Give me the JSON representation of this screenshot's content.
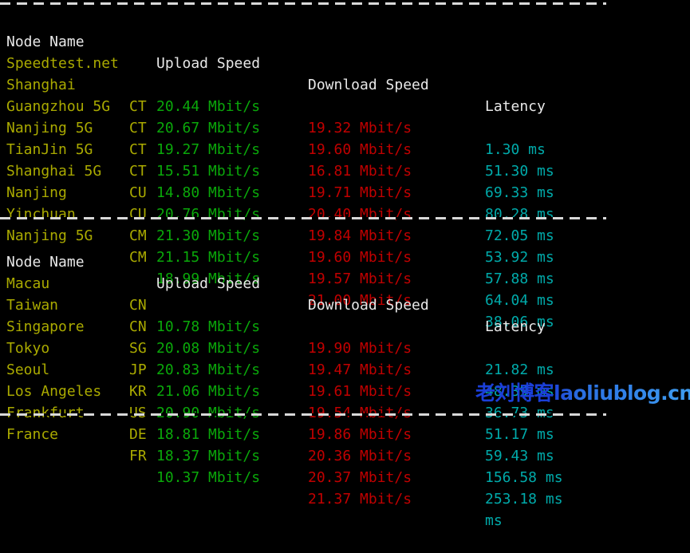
{
  "terminal": {
    "background_color": "#000000",
    "separator_color": "#d8d8d8"
  },
  "colors": {
    "header": "#e8e8e8",
    "node_name": "#aaaa00",
    "isp": "#aaaa00",
    "upload": "#0aa80a",
    "download": "#c00000",
    "latency": "#00aaaa",
    "watermark": "#1b3fd8"
  },
  "headers": {
    "node_name": "Node Name",
    "isp": "",
    "upload_speed": "Upload Speed",
    "download_speed": "Download Speed",
    "latency": "Latency"
  },
  "table_domestic": {
    "rows": [
      {
        "node": "Speedtest.net",
        "isp": "",
        "upload": "20.44 Mbit/s",
        "download": "19.32 Mbit/s",
        "latency": "1.30 ms"
      },
      {
        "node": "Shanghai",
        "isp": "CT",
        "upload": "20.67 Mbit/s",
        "download": "19.60 Mbit/s",
        "latency": "51.30 ms"
      },
      {
        "node": "Guangzhou 5G",
        "isp": "CT",
        "upload": "19.27 Mbit/s",
        "download": "16.81 Mbit/s",
        "latency": "69.33 ms"
      },
      {
        "node": "Nanjing 5G",
        "isp": "CT",
        "upload": "15.51 Mbit/s",
        "download": "19.71 Mbit/s",
        "latency": "80.28 ms"
      },
      {
        "node": "TianJin 5G",
        "isp": "CT",
        "upload": "14.80 Mbit/s",
        "download": "20.40 Mbit/s",
        "latency": "72.05 ms"
      },
      {
        "node": "Shanghai 5G",
        "isp": "CU",
        "upload": "20.76 Mbit/s",
        "download": "19.84 Mbit/s",
        "latency": "53.92 ms"
      },
      {
        "node": "Nanjing",
        "isp": "CU",
        "upload": "21.30 Mbit/s",
        "download": "19.60 Mbit/s",
        "latency": "57.88 ms"
      },
      {
        "node": "Yinchuan",
        "isp": "CM",
        "upload": "21.15 Mbit/s",
        "download": "19.57 Mbit/s",
        "latency": "64.04 ms"
      },
      {
        "node": "Nanjing 5G",
        "isp": "CM",
        "upload": "18.99 Mbit/s",
        "download": "21.00 Mbit/s",
        "latency": "38.06 ms"
      }
    ]
  },
  "table_international": {
    "rows": [
      {
        "node": "Macau",
        "isp": "CN",
        "upload": "10.78 Mbit/s",
        "download": "19.90 Mbit/s",
        "latency": "21.82 ms"
      },
      {
        "node": "Taiwan",
        "isp": "CN",
        "upload": "20.08 Mbit/s",
        "download": "19.47 Mbit/s",
        "latency": "48.39 ms"
      },
      {
        "node": "Singapore",
        "isp": "SG",
        "upload": "20.83 Mbit/s",
        "download": "19.61 Mbit/s",
        "latency": "36.73 ms"
      },
      {
        "node": "Tokyo",
        "isp": "JP",
        "upload": "21.06 Mbit/s",
        "download": "19.54 Mbit/s",
        "latency": "51.17 ms"
      },
      {
        "node": "Seoul",
        "isp": "KR",
        "upload": "20.90 Mbit/s",
        "download": "19.86 Mbit/s",
        "latency": "59.43 ms"
      },
      {
        "node": "Los Angeles",
        "isp": "US",
        "upload": "18.81 Mbit/s",
        "download": "20.36 Mbit/s",
        "latency": "156.58 ms"
      },
      {
        "node": "Frankfurt",
        "isp": "DE",
        "upload": "18.37 Mbit/s",
        "download": "20.37 Mbit/s",
        "latency": "253.18 ms"
      },
      {
        "node": "France",
        "isp": "FR",
        "upload": "10.37 Mbit/s",
        "download": "21.37 Mbit/s",
        "latency": "ms"
      }
    ]
  },
  "watermark": {
    "cjk_text": "老刘博客",
    "domain_text": "laoliublog.cn"
  }
}
